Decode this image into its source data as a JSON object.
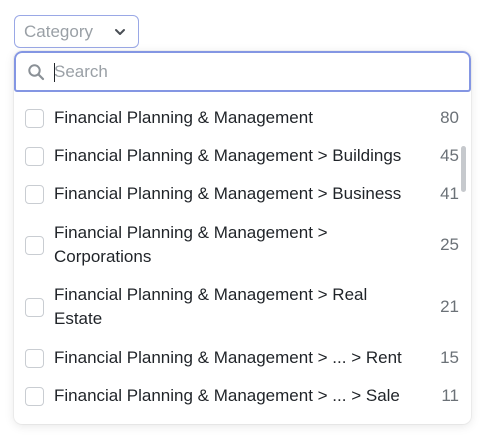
{
  "category_button": {
    "label": "Category",
    "icon": "chevron-down-icon"
  },
  "search": {
    "placeholder": "Search",
    "value": "",
    "icon": "search-icon"
  },
  "items": [
    {
      "label": "Financial Planning & Management",
      "count": "80",
      "checked": false
    },
    {
      "label": "Financial Planning & Management > Buildings",
      "count": "45",
      "checked": false
    },
    {
      "label": "Financial Planning & Management > Business",
      "count": "41",
      "checked": false
    },
    {
      "label": "Financial Planning & Management > Corporations",
      "count": "25",
      "checked": false
    },
    {
      "label": "Financial Planning & Management > Real Estate",
      "count": "21",
      "checked": false
    },
    {
      "label": "Financial Planning & Management > ... > Rent",
      "count": "15",
      "checked": false
    },
    {
      "label": "Financial Planning & Management > ... > Sale",
      "count": "11",
      "checked": false
    }
  ],
  "colors": {
    "accent_border": "#8496e3",
    "text": "#1f2328",
    "muted": "#9aa0a6",
    "count": "#6b7177"
  }
}
